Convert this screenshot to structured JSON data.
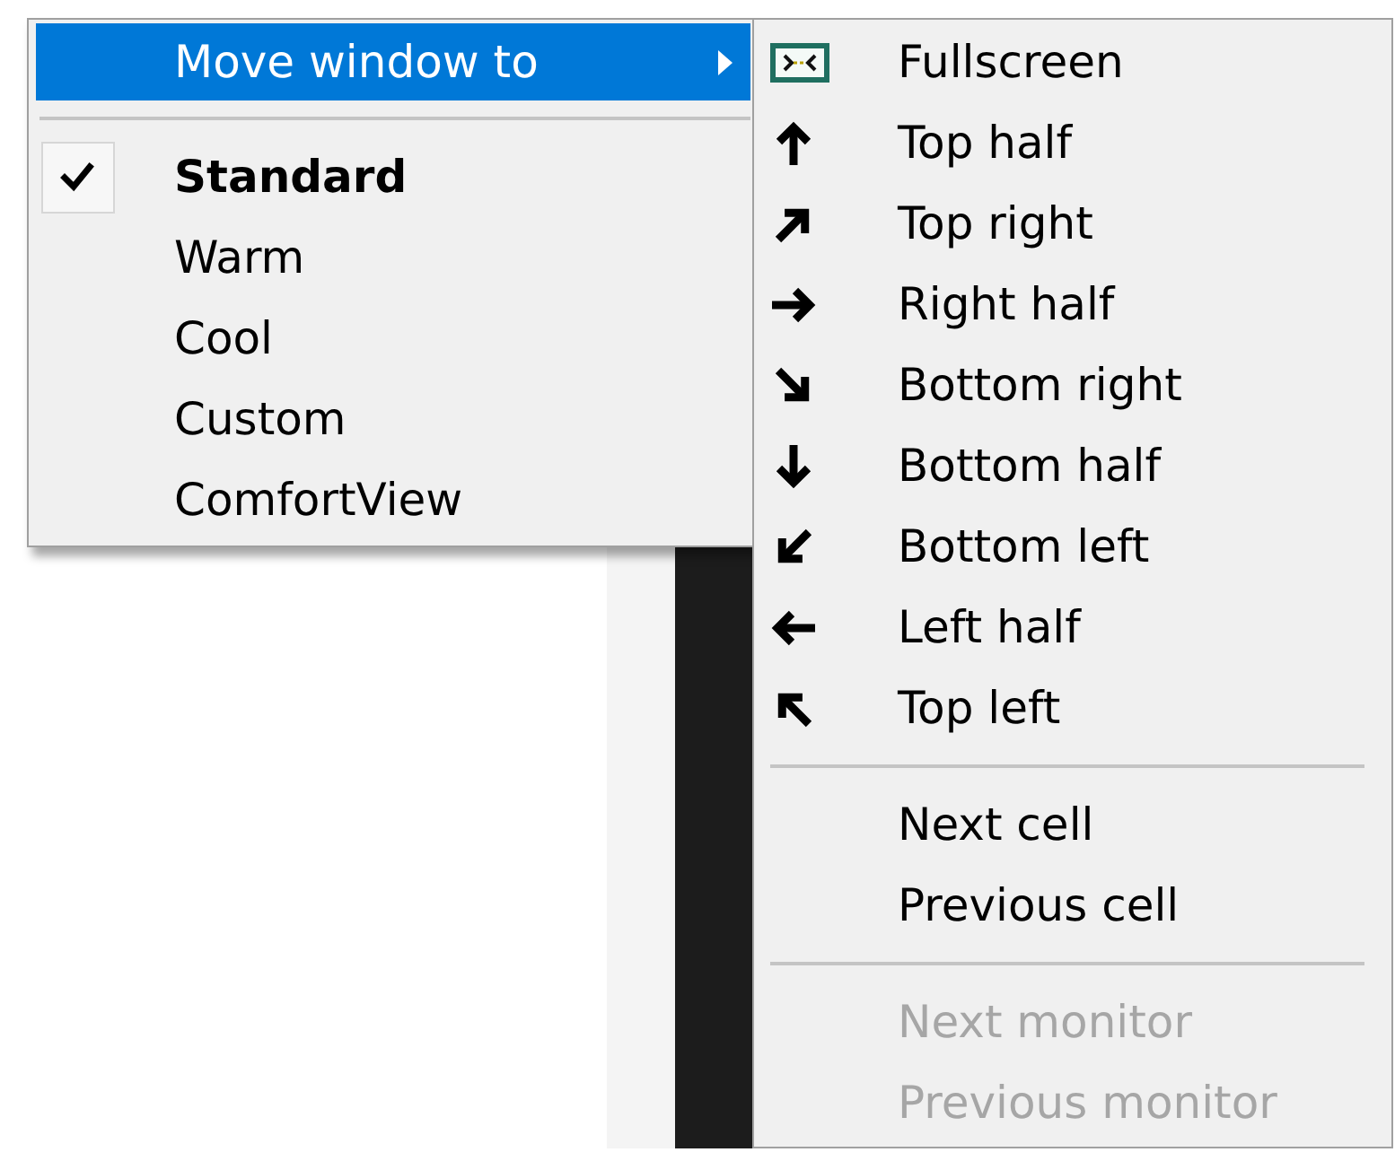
{
  "menu": {
    "items": [
      {
        "kind": "submenu",
        "label": "Move window to",
        "selected": true
      },
      {
        "kind": "separator"
      },
      {
        "kind": "option",
        "label": "Standard",
        "checked": true,
        "selected": false
      },
      {
        "kind": "option",
        "label": "Warm",
        "checked": false,
        "selected": false
      },
      {
        "kind": "option",
        "label": "Cool",
        "checked": false,
        "selected": false
      },
      {
        "kind": "option",
        "label": "Custom",
        "checked": false,
        "selected": false
      },
      {
        "kind": "option",
        "label": "ComfortView",
        "checked": false,
        "selected": false
      }
    ]
  },
  "submenu": {
    "items": [
      {
        "kind": "command",
        "label": "Fullscreen",
        "disabled": false,
        "selected": false
      },
      {
        "kind": "command",
        "label": "Top half",
        "disabled": false,
        "selected": false
      },
      {
        "kind": "command",
        "label": "Top right",
        "disabled": false,
        "selected": false
      },
      {
        "kind": "command",
        "label": "Right half",
        "disabled": false,
        "selected": false
      },
      {
        "kind": "command",
        "label": "Bottom right",
        "disabled": false,
        "selected": false
      },
      {
        "kind": "command",
        "label": "Bottom half",
        "disabled": false,
        "selected": false
      },
      {
        "kind": "command",
        "label": "Bottom left",
        "disabled": false,
        "selected": false
      },
      {
        "kind": "command",
        "label": "Left half",
        "disabled": false,
        "selected": false
      },
      {
        "kind": "command",
        "label": "Top left",
        "disabled": false,
        "selected": false
      },
      {
        "kind": "separator"
      },
      {
        "kind": "command",
        "label": "Next cell",
        "disabled": false,
        "selected": false
      },
      {
        "kind": "command",
        "label": "Previous cell",
        "disabled": false,
        "selected": false
      },
      {
        "kind": "separator"
      },
      {
        "kind": "command",
        "label": "Next monitor",
        "disabled": true,
        "selected": false
      },
      {
        "kind": "command",
        "label": "Previous monitor",
        "disabled": true,
        "selected": false
      }
    ]
  }
}
